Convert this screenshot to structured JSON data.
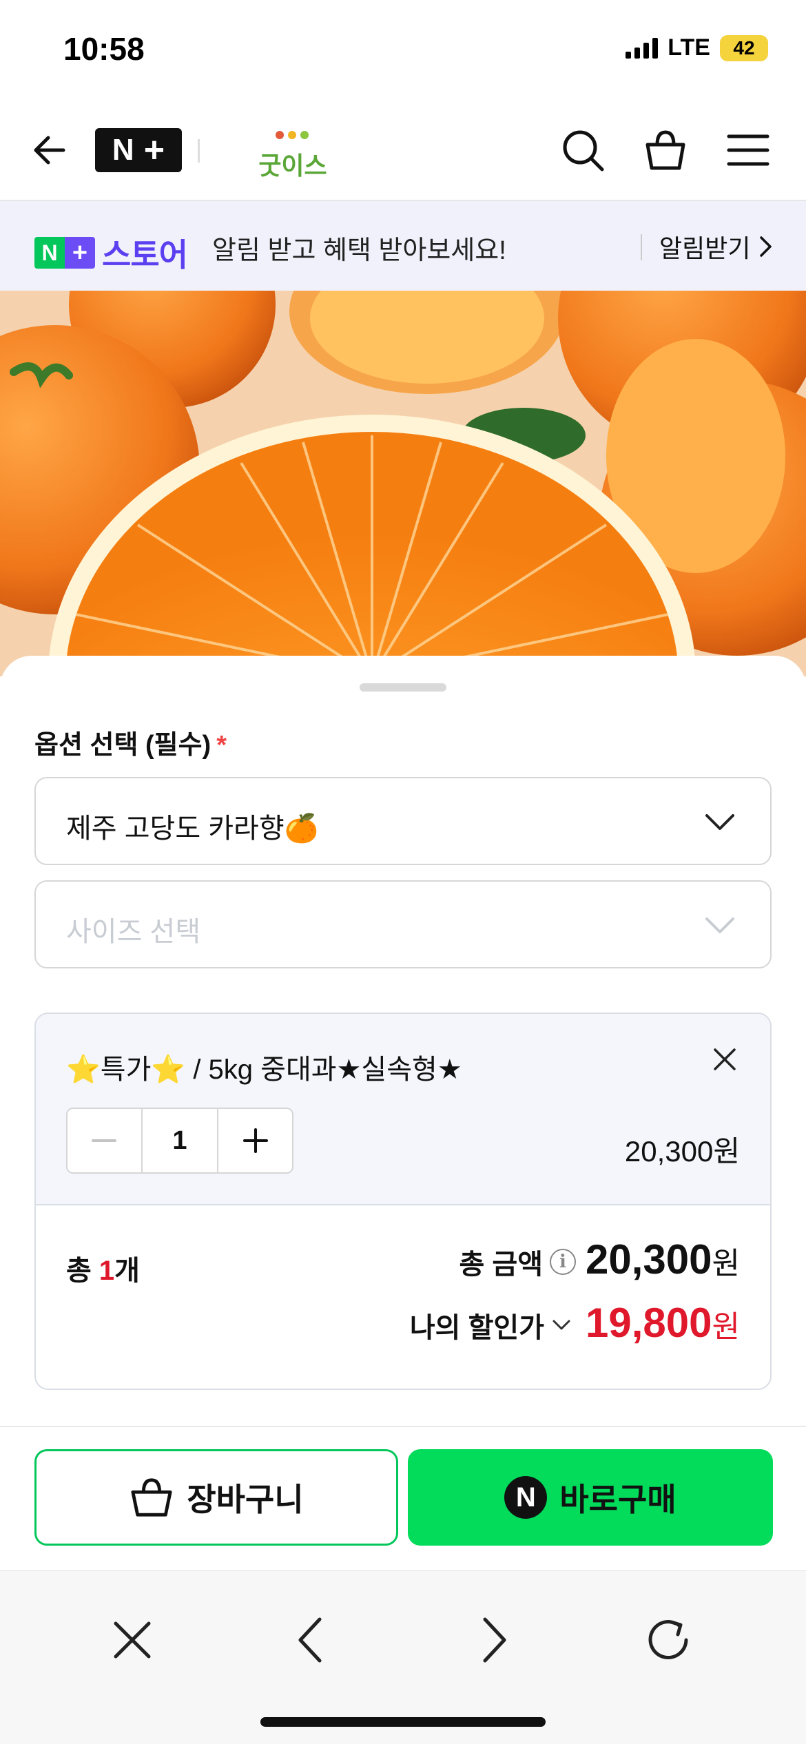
{
  "status_bar": {
    "time": "10:58",
    "network": "LTE",
    "battery": "42",
    "battery_color": "#f4d33c"
  },
  "nav": {
    "back_icon": "arrow-left-icon",
    "brand_logo": "N+",
    "store_logo": "굿이스",
    "icons": [
      "search-icon",
      "shopping-bag-icon",
      "hamburger-menu-icon"
    ]
  },
  "banner": {
    "logo_n": "N",
    "logo_plus": "+",
    "logo_store": "스토어",
    "text": "알림 받고 혜택 받아보세요!",
    "action_label": "알림받기",
    "brand_color": "#5b3ff0"
  },
  "product_image": {
    "description_icon": "orange-fruit-image"
  },
  "options": {
    "heading": "옵션 선택 (필수)",
    "required_mark": "*",
    "select_product": {
      "value": "제주 고당도 카라향🍊"
    },
    "select_size": {
      "placeholder": "사이즈 선택"
    }
  },
  "selected_item": {
    "name": "⭐특가⭐ / 5kg 중대과★실속형★",
    "quantity": "1",
    "price": "20,300원"
  },
  "summary": {
    "count_prefix": "총 ",
    "count": "1",
    "count_suffix": "개",
    "total_label": "총 금액",
    "total_value": "20,300",
    "total_unit": "원",
    "discount_label": "나의 할인가",
    "discount_value": "19,800",
    "discount_unit": "원",
    "accent_color": "#e0182c"
  },
  "actions": {
    "cart_label": "장바구니",
    "buy_label": "바로구매",
    "buy_badge": "N",
    "buy_color": "#03db5b"
  },
  "browser_toolbar": {
    "icons": [
      "close-icon",
      "back-icon",
      "forward-icon",
      "reload-icon"
    ]
  }
}
